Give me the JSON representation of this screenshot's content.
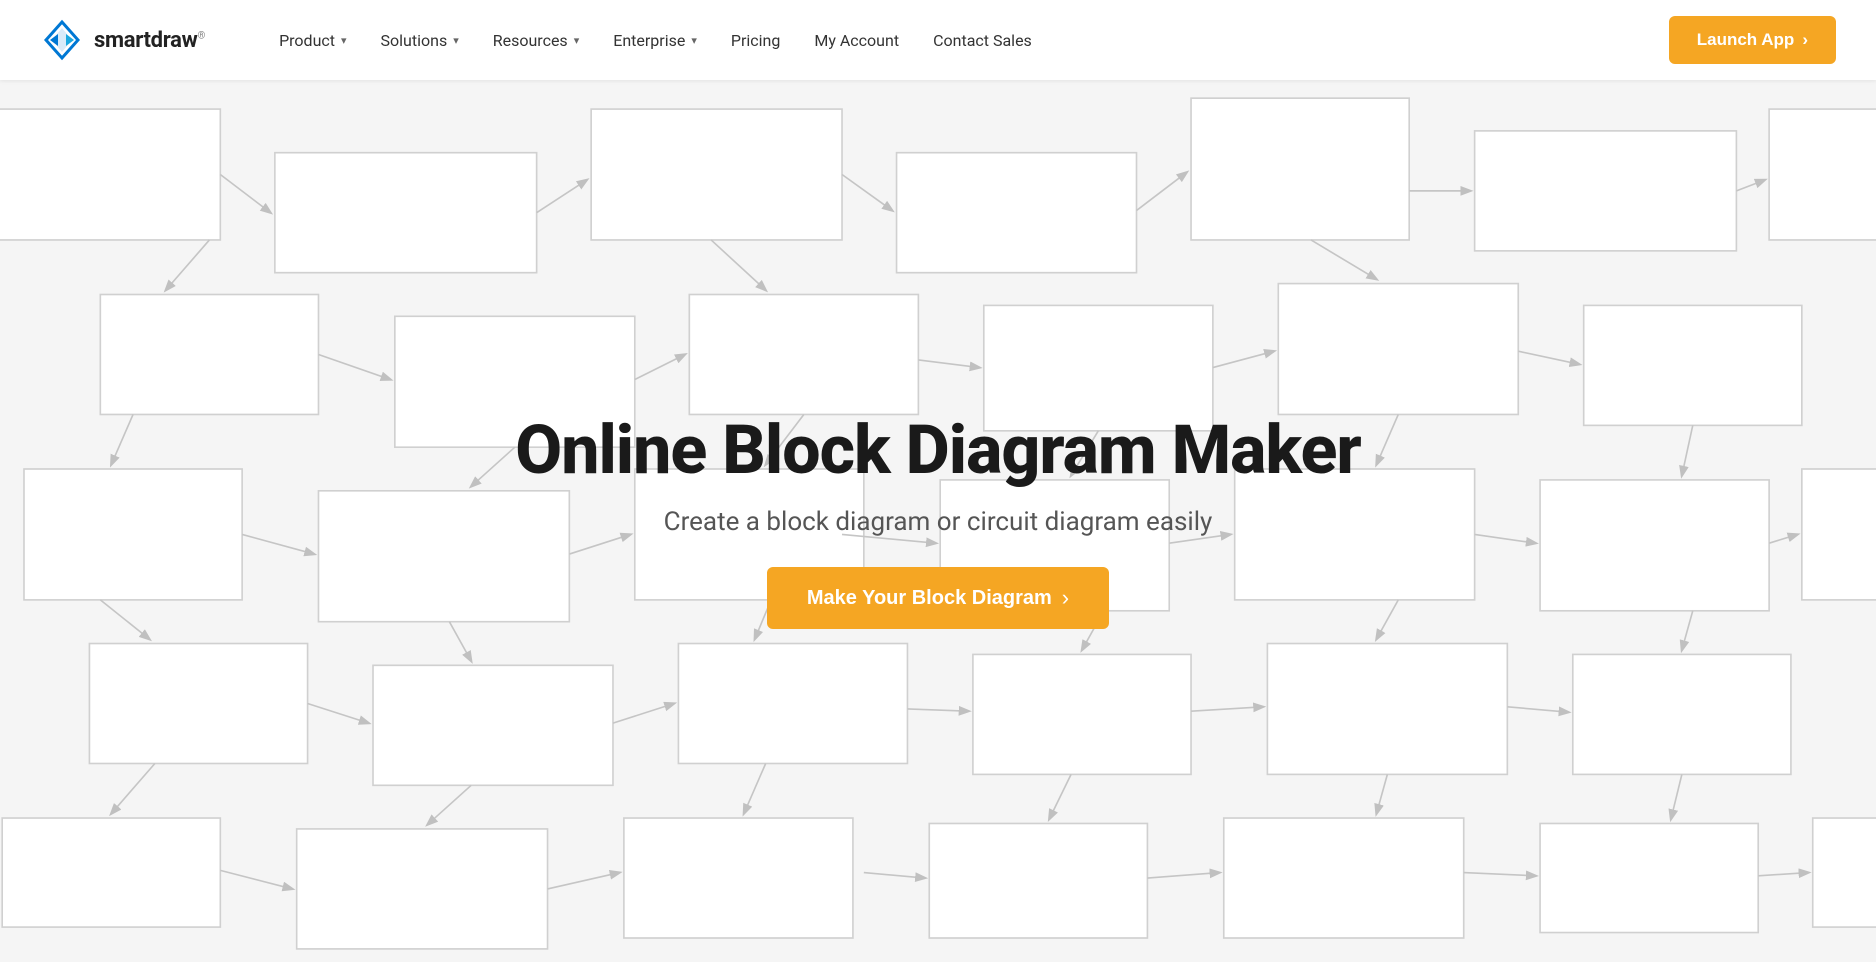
{
  "logo": {
    "text_light": "smart",
    "text_bold": "draw",
    "trademark": "®"
  },
  "nav": {
    "items": [
      {
        "label": "Product",
        "has_dropdown": true
      },
      {
        "label": "Solutions",
        "has_dropdown": true
      },
      {
        "label": "Resources",
        "has_dropdown": true
      },
      {
        "label": "Enterprise",
        "has_dropdown": true
      },
      {
        "label": "Pricing",
        "has_dropdown": false
      },
      {
        "label": "My Account",
        "has_dropdown": false
      },
      {
        "label": "Contact Sales",
        "has_dropdown": false
      }
    ],
    "launch_btn": "Launch App",
    "launch_icon": "›"
  },
  "hero": {
    "title": "Online Block Diagram Maker",
    "subtitle": "Create a block diagram or circuit diagram easily",
    "cta_label": "Make Your Block Diagram",
    "cta_icon": "›"
  },
  "colors": {
    "accent": "#F5A623",
    "logo_blue": "#0078D4",
    "logo_blue_dark": "#005fa3"
  }
}
